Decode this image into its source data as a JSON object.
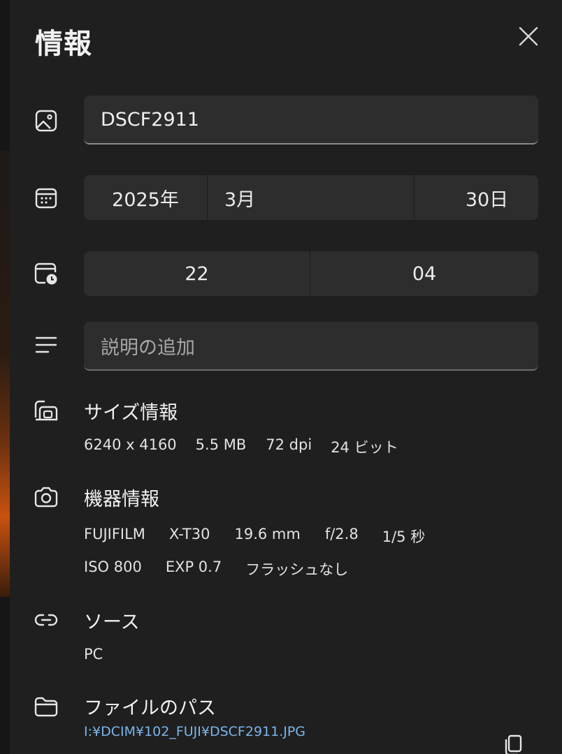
{
  "panel": {
    "title": "情報",
    "file_name": "DSCF2911",
    "date": {
      "year": "2025年",
      "month": "3月",
      "day": "30日"
    },
    "time": {
      "hour": "22",
      "minute": "04"
    },
    "description_placeholder": "説明の追加"
  },
  "size_info": {
    "title": "サイズ情報",
    "dimensions": "6240 x 4160",
    "file_size": "5.5 MB",
    "resolution": "72 dpi",
    "bit_depth": "24 ビット"
  },
  "device_info": {
    "title": "機器情報",
    "maker": "FUJIFILM",
    "model": "X-T30",
    "focal_length": "19.6 mm",
    "aperture": "f/2.8",
    "shutter": "1/5 秒",
    "iso": "ISO 800",
    "exposure": "EXP 0.7",
    "flash": "フラッシュなし"
  },
  "source": {
    "title": "ソース",
    "value": "PC"
  },
  "file_path": {
    "title": "ファイルのパス",
    "value": "I:¥DCIM¥102_FUJI¥DSCF2911.JPG"
  },
  "icons": {
    "close": "close-icon",
    "image": "image-icon",
    "calendar": "calendar-icon",
    "calendar_clock": "calendar-clock-icon",
    "text_lines": "text-lines-icon",
    "size": "size-icon",
    "camera": "camera-icon",
    "link": "link-icon",
    "folder": "folder-icon",
    "copy": "copy-icon"
  },
  "colors": {
    "background": "#1f1f1f",
    "field": "#2d2d2d",
    "link": "#7bb4ea"
  }
}
